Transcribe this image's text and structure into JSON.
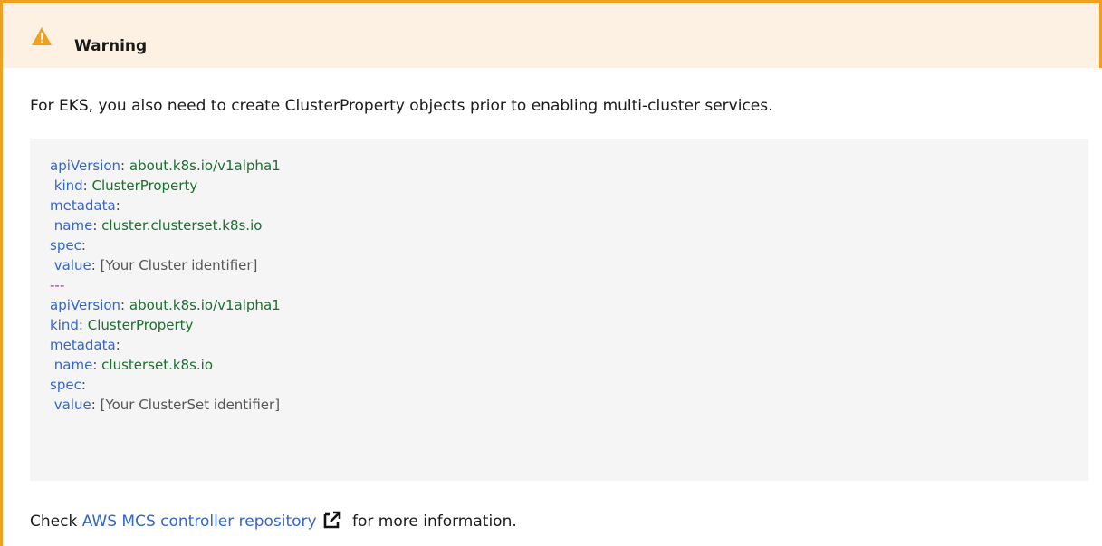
{
  "callout": {
    "title": "Warning",
    "icon": "warning-icon",
    "accent_color": "#f0a020",
    "header_bg": "#fdf1e3"
  },
  "intro_text": "For EKS, you also need to create ClusterProperty objects prior to enabling multi-cluster services.",
  "code": {
    "lines": [
      {
        "indent": "",
        "key": "apiVersion",
        "sep": ": ",
        "value": "about.k8s.io/v1alpha1"
      },
      {
        "indent": " ",
        "key": "kind",
        "sep": ": ",
        "value": "ClusterProperty"
      },
      {
        "indent": "",
        "key": "metadata",
        "sep": ":",
        "value": ""
      },
      {
        "indent": " ",
        "key": "name",
        "sep": ": ",
        "value": "cluster.clusterset.k8s.io"
      },
      {
        "indent": "",
        "key": "spec",
        "sep": ":",
        "value": ""
      },
      {
        "indent": " ",
        "key": "value",
        "sep": ": ",
        "value": "[Your Cluster identifier]"
      },
      {
        "separator": "---"
      },
      {
        "indent": "",
        "key": "apiVersion",
        "sep": ": ",
        "value": "about.k8s.io/v1alpha1"
      },
      {
        "indent": "",
        "key": "kind",
        "sep": ": ",
        "value": "ClusterProperty"
      },
      {
        "indent": "",
        "key": "metadata",
        "sep": ":",
        "value": ""
      },
      {
        "indent": " ",
        "key": "name",
        "sep": ": ",
        "value": "clusterset.k8s.io"
      },
      {
        "indent": "",
        "key": "spec",
        "sep": ":",
        "value": ""
      },
      {
        "indent": " ",
        "key": "value",
        "sep": ": ",
        "value": "[Your ClusterSet identifier]"
      }
    ]
  },
  "footer": {
    "prefix": "Check ",
    "link_text": "AWS MCS controller repository",
    "link_icon": "external-link-icon",
    "suffix": " for more information."
  }
}
